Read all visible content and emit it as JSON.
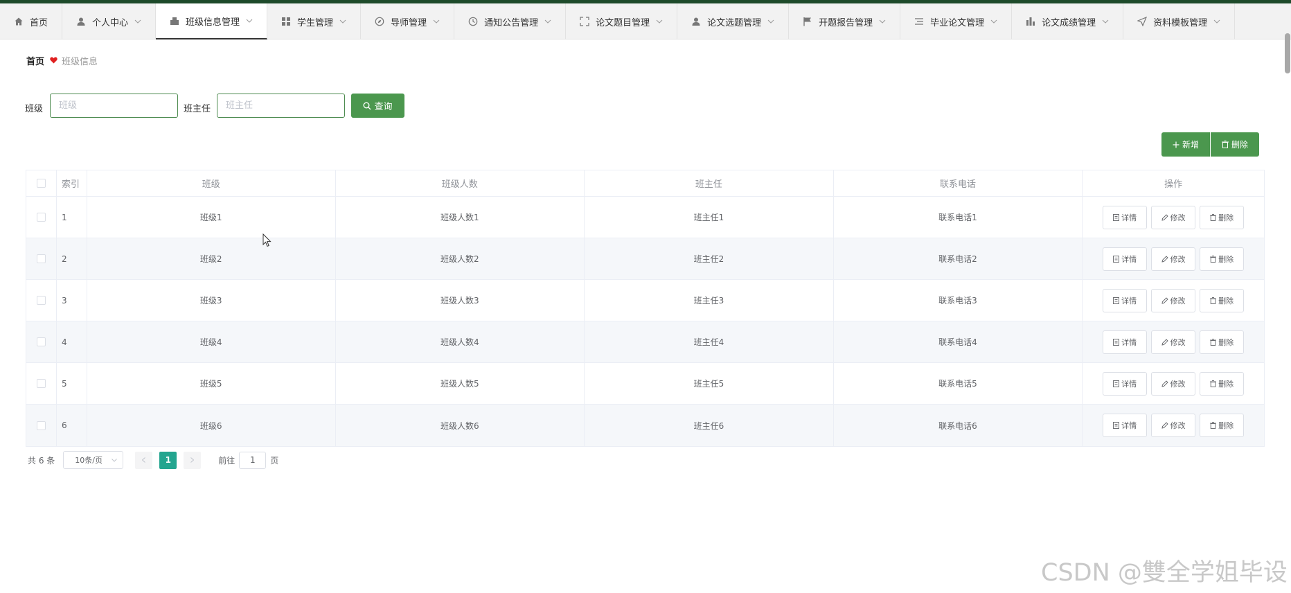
{
  "nav": [
    {
      "label": "首页",
      "icon": "home-icon",
      "caret": false,
      "active": false
    },
    {
      "label": "个人中心",
      "icon": "user-icon",
      "caret": true,
      "active": false
    },
    {
      "label": "班级信息管理",
      "icon": "class-icon",
      "caret": true,
      "active": true
    },
    {
      "label": "学生管理",
      "icon": "grid-icon",
      "caret": true,
      "active": false
    },
    {
      "label": "导师管理",
      "icon": "compass-icon",
      "caret": true,
      "active": false
    },
    {
      "label": "通知公告管理",
      "icon": "clock-icon",
      "caret": true,
      "active": false
    },
    {
      "label": "论文题目管理",
      "icon": "expand-icon",
      "caret": true,
      "active": false
    },
    {
      "label": "论文选题管理",
      "icon": "user-icon",
      "caret": true,
      "active": false
    },
    {
      "label": "开题报告管理",
      "icon": "flag-icon",
      "caret": true,
      "active": false
    },
    {
      "label": "毕业论文管理",
      "icon": "list-icon",
      "caret": true,
      "active": false
    },
    {
      "label": "论文成绩管理",
      "icon": "chart-icon",
      "caret": true,
      "active": false
    },
    {
      "label": "资料模板管理",
      "icon": "send-icon",
      "caret": true,
      "active": false
    }
  ],
  "breadcrumb": {
    "home": "首页",
    "current": "班级信息"
  },
  "search": {
    "class_label": "班级",
    "class_placeholder": "班级",
    "teacher_label": "班主任",
    "teacher_placeholder": "班主任",
    "button": "查询"
  },
  "actions": {
    "add": "新增",
    "delete": "删除"
  },
  "table": {
    "headers": {
      "index": "索引",
      "class": "班级",
      "count": "班级人数",
      "teacher": "班主任",
      "phone": "联系电话",
      "ops": "操作"
    },
    "row_buttons": {
      "detail": "详情",
      "edit": "修改",
      "delete": "删除"
    },
    "rows": [
      {
        "index": "1",
        "class": "班级1",
        "count": "班级人数1",
        "teacher": "班主任1",
        "phone": "联系电话1"
      },
      {
        "index": "2",
        "class": "班级2",
        "count": "班级人数2",
        "teacher": "班主任2",
        "phone": "联系电话2"
      },
      {
        "index": "3",
        "class": "班级3",
        "count": "班级人数3",
        "teacher": "班主任3",
        "phone": "联系电话3"
      },
      {
        "index": "4",
        "class": "班级4",
        "count": "班级人数4",
        "teacher": "班主任4",
        "phone": "联系电话4"
      },
      {
        "index": "5",
        "class": "班级5",
        "count": "班级人数5",
        "teacher": "班主任5",
        "phone": "联系电话5"
      },
      {
        "index": "6",
        "class": "班级6",
        "count": "班级人数6",
        "teacher": "班主任6",
        "phone": "联系电话6"
      }
    ]
  },
  "pagination": {
    "total": "共 6 条",
    "page_size": "10条/页",
    "current": "1",
    "goto": "前往",
    "goto_value": "1",
    "page_suffix": "页"
  },
  "watermark": "CSDN @雙全学姐毕设",
  "colors": {
    "accent": "#4b974e",
    "pager_active": "#23a58f",
    "heart": "#e02020",
    "topline": "#1d4a2a"
  }
}
